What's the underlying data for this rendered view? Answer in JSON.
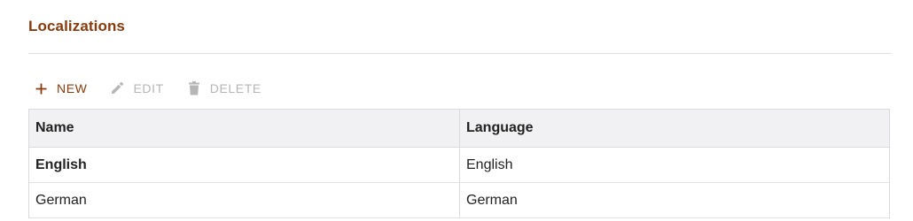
{
  "section": {
    "title": "Localizations"
  },
  "toolbar": {
    "new_label": "NEW",
    "edit_label": "EDIT",
    "delete_label": "DELETE",
    "icons": {
      "new": "plus-icon",
      "edit": "pencil-icon",
      "delete": "trash-icon"
    },
    "colors": {
      "enabled": "#8a3a0c",
      "disabled": "#b6b6b6"
    }
  },
  "table": {
    "columns": [
      "Name",
      "Language"
    ],
    "rows": [
      {
        "name": "English",
        "language": "English",
        "bold": true
      },
      {
        "name": "German",
        "language": "German",
        "bold": false
      }
    ]
  }
}
